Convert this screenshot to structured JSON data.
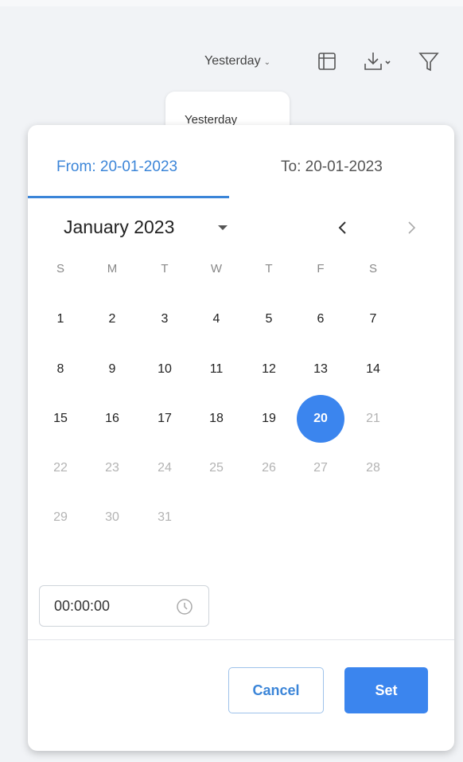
{
  "toolbar": {
    "range_label": "Yesterday",
    "icons": [
      "table-layout-icon",
      "download-icon",
      "filter-icon"
    ]
  },
  "dropdown": {
    "selected_option": "Yesterday"
  },
  "picker": {
    "tabs": {
      "from": "From: 20-01-2023",
      "to": "To: 20-01-2023"
    },
    "month_label": "January 2023",
    "weekdays": [
      "S",
      "M",
      "T",
      "W",
      "T",
      "F",
      "S"
    ],
    "weeks": [
      [
        "1",
        "2",
        "3",
        "4",
        "5",
        "6",
        "7"
      ],
      [
        "8",
        "9",
        "10",
        "11",
        "12",
        "13",
        "14"
      ],
      [
        "15",
        "16",
        "17",
        "18",
        "19",
        "20",
        "21"
      ],
      [
        "22",
        "23",
        "24",
        "25",
        "26",
        "27",
        "28"
      ],
      [
        "29",
        "30",
        "31"
      ]
    ],
    "selected_day": "20",
    "last_enabled_day": 20,
    "time_value": "00:00:00",
    "cancel_label": "Cancel",
    "set_label": "Set"
  },
  "colors": {
    "accent": "#3b85ee",
    "tab_active": "#3b85d8",
    "disabled_text": "#b3b3b3"
  }
}
